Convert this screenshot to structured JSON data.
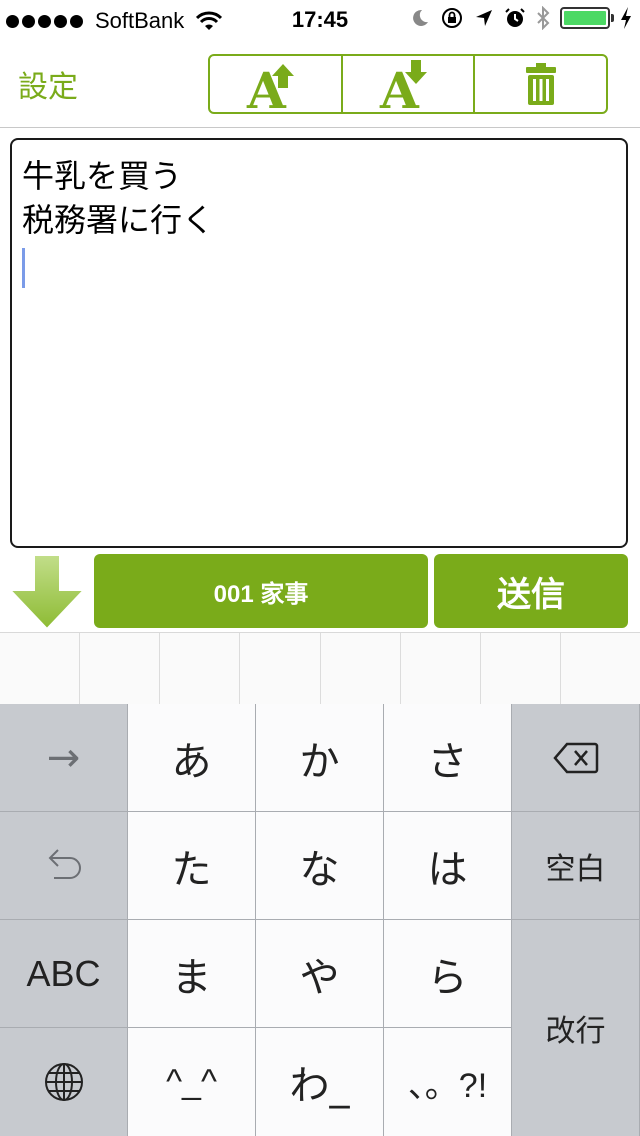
{
  "status_bar": {
    "carrier": "SoftBank",
    "time": "17:45",
    "signal_dots": 5,
    "battery_level": 1.0
  },
  "nav": {
    "settings_label": "設定",
    "toolbar_icons": [
      "font-increase-icon",
      "font-decrease-icon",
      "trash-icon"
    ]
  },
  "memo": {
    "lines": [
      "牛乳を買う",
      "税務署に行く"
    ]
  },
  "actions": {
    "category_label": "001 家事",
    "send_label": "送信"
  },
  "keyboard": {
    "row1": [
      "→",
      "あ",
      "か",
      "さ"
    ],
    "row2": [
      "た",
      "な",
      "は",
      "空白"
    ],
    "row3": [
      "ABC",
      "ま",
      "や",
      "ら"
    ],
    "row4": [
      "^_^",
      "わ_",
      "、。?!"
    ],
    "enter_label": "改行"
  },
  "colors": {
    "accent": "#7aab1a",
    "keyboard_gray": "#c7cacf",
    "key_white": "#fbfbfc",
    "caret": "#7b9be8"
  }
}
